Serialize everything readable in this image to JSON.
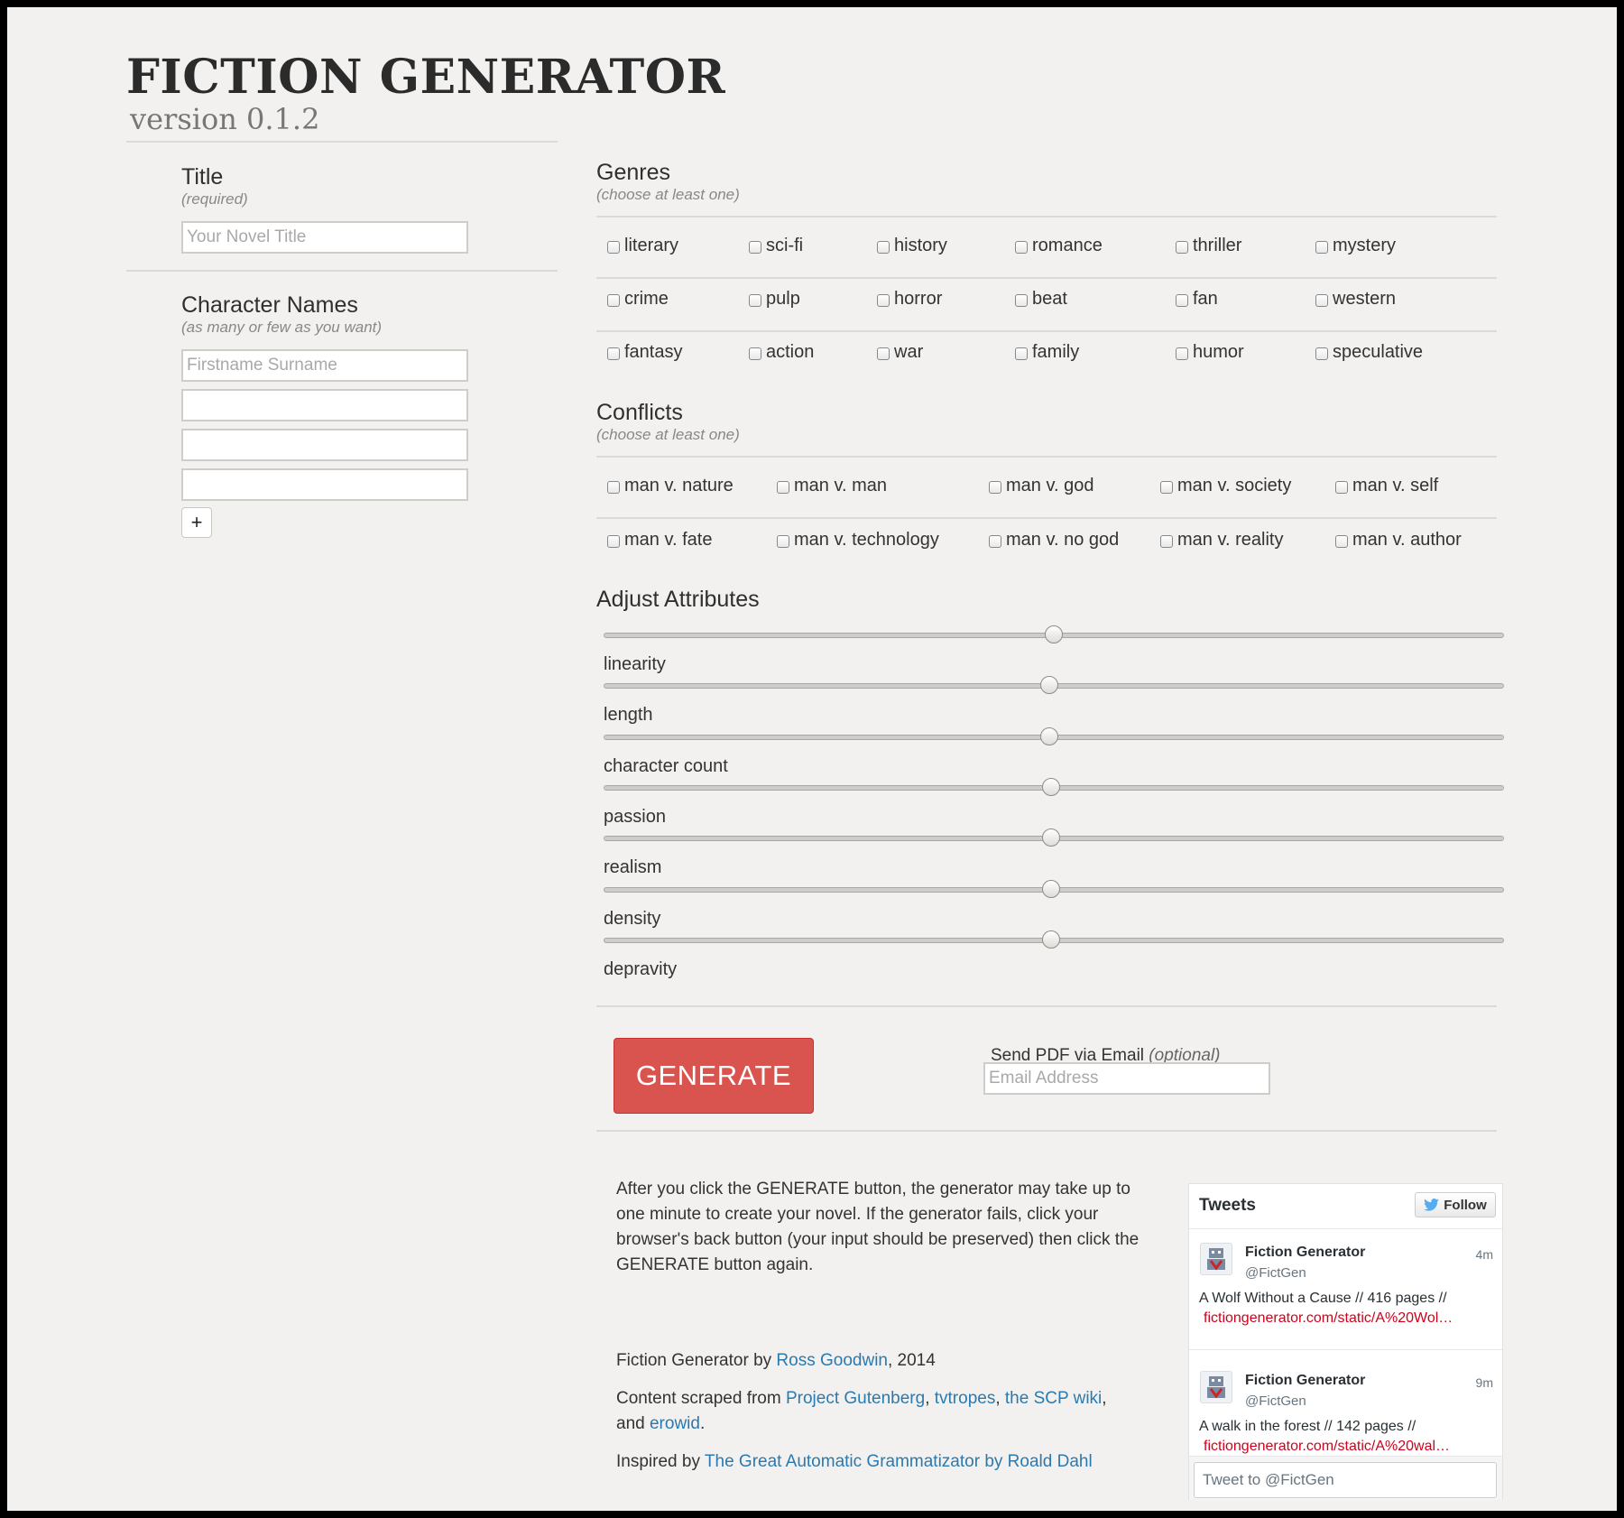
{
  "header": {
    "title": "FICTION GENERATOR",
    "version": "version 0.1.2"
  },
  "title_section": {
    "label": "Title",
    "hint": "(required)",
    "placeholder": "Your Novel Title"
  },
  "characters_section": {
    "label": "Character Names",
    "hint": "(as many or few as you want)",
    "first_placeholder": "Firstname Surname",
    "add_label": "+"
  },
  "genres": {
    "label": "Genres",
    "hint": "(choose at least one)",
    "rows": [
      [
        "literary",
        "sci-fi",
        "history",
        "romance",
        "thriller",
        "mystery"
      ],
      [
        "crime",
        "pulp",
        "horror",
        "beat",
        "fan",
        "western"
      ],
      [
        "fantasy",
        "action",
        "war",
        "family",
        "humor",
        "speculative"
      ]
    ]
  },
  "conflicts": {
    "label": "Conflicts",
    "hint": "(choose at least one)",
    "rows": [
      [
        "man v. nature",
        "man v. man",
        "man v. god",
        "man v. society",
        "man v. self"
      ],
      [
        "man v. fate",
        "man v. technology",
        "man v. no god",
        "man v. reality",
        "man v. author"
      ]
    ]
  },
  "attributes": {
    "label": "Adjust Attributes",
    "sliders": [
      {
        "label": "linearity",
        "value": 0.5
      },
      {
        "label": "length",
        "value": 0.495
      },
      {
        "label": "character count",
        "value": 0.495
      },
      {
        "label": "passion",
        "value": 0.497
      },
      {
        "label": "realism",
        "value": 0.497
      },
      {
        "label": "density",
        "value": 0.497
      },
      {
        "label": "depravity",
        "value": 0.497
      }
    ]
  },
  "generate": {
    "button_label": "GENERATE",
    "email_label": "Send PDF via Email",
    "email_optional": "(optional)",
    "email_placeholder": "Email Address"
  },
  "info": {
    "instructions": "After you click the GENERATE button, the generator may take up to one minute to create your novel. If the generator fails, click your browser's back button (your input should be preserved) then click the GENERATE button again.",
    "credit_prefix": "Fiction Generator by ",
    "credit_author": "Ross Goodwin",
    "credit_suffix": ", 2014",
    "content_prefix": "Content scraped from ",
    "source_1": "Project Gutenberg",
    "source_2": "tvtropes",
    "source_3": "the SCP wiki",
    "content_and": "and ",
    "source_4": "erowid",
    "inspired_prefix": "Inspired by ",
    "inspired_link": "The Great Automatic Grammatizator by Roald Dahl",
    "comma": ",",
    "period": "."
  },
  "tweets": {
    "title": "Tweets",
    "follow_label": "Follow",
    "items": [
      {
        "name": "Fiction Generator",
        "handle": "@FictGen",
        "time": "4m",
        "text": "A Wolf Without a Cause // 416 pages //",
        "link": "fictiongenerator.com/static/A%20Wol…"
      },
      {
        "name": "Fiction Generator",
        "handle": "@FictGen",
        "time": "9m",
        "text": "A walk in the forest // 142 pages //",
        "link": "fictiongenerator.com/static/A%20wal…"
      }
    ],
    "compose_placeholder": "Tweet to @FictGen"
  },
  "icons": {
    "checkbox": "checkbox-icon",
    "twitter": "twitter-bird-icon",
    "avatar": "robot-avatar-icon"
  },
  "colors": {
    "background": "#f2f1ef",
    "generate": "#d9534f",
    "link": "#2a7ab0",
    "tweet_link": "#d0021b"
  }
}
